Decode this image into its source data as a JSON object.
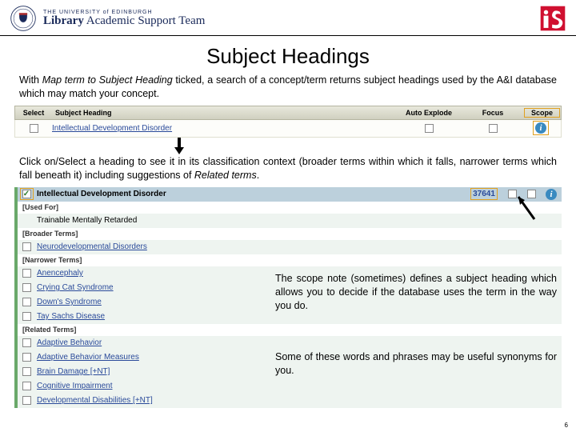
{
  "header": {
    "uni": "THE UNIVERSITY of EDINBURGH",
    "team_bold": "Library",
    "team_rest": " Academic Support Team"
  },
  "title": "Subject Headings",
  "para1a": "With ",
  "para1_ital": "Map term to Subject Heading",
  "para1b": " ticked, a search of a concept/term returns subject headings used by the A&I database which may match your concept.",
  "db1": {
    "cols": {
      "select": "Select",
      "sh": "Subject Heading",
      "ae": "Auto Explode",
      "focus": "Focus",
      "scope": "Scope"
    },
    "row": {
      "sh_link": "Intellectual Development Disorder"
    }
  },
  "para2a": "Click on/Select a heading to see it in its classification context (broader terms within which it falls, narrower terms which fall beneath it) including suggestions of ",
  "para2_ital": "Related terms",
  "para2b": ".",
  "db2": {
    "main": {
      "label": "Intellectual Development Disorder",
      "hits": "37641"
    },
    "used_for": {
      "section": "[Used For]",
      "item": "Trainable Mentally Retarded"
    },
    "broader": {
      "section": "[Broader Terms]",
      "item": "Neurodevelopmental Disorders"
    },
    "narrower": {
      "section": "[Narrower Terms]",
      "items": [
        "Anencephaly",
        "Crying Cat Syndrome",
        "Down's Syndrome",
        "Tay Sachs Disease"
      ]
    },
    "related": {
      "section": "[Related Terms]",
      "items": [
        "Adaptive Behavior",
        "Adaptive Behavior Measures",
        "Brain Damage [+NT]",
        "Cognitive Impairment",
        "Developmental Disabilities [+NT]"
      ]
    }
  },
  "note1": "The scope note (sometimes) defines a subject heading which allows you to decide if the database uses the term in the way you do.",
  "note2": "Some of these words and phrases may be useful synonyms for you.",
  "page_num": "6"
}
